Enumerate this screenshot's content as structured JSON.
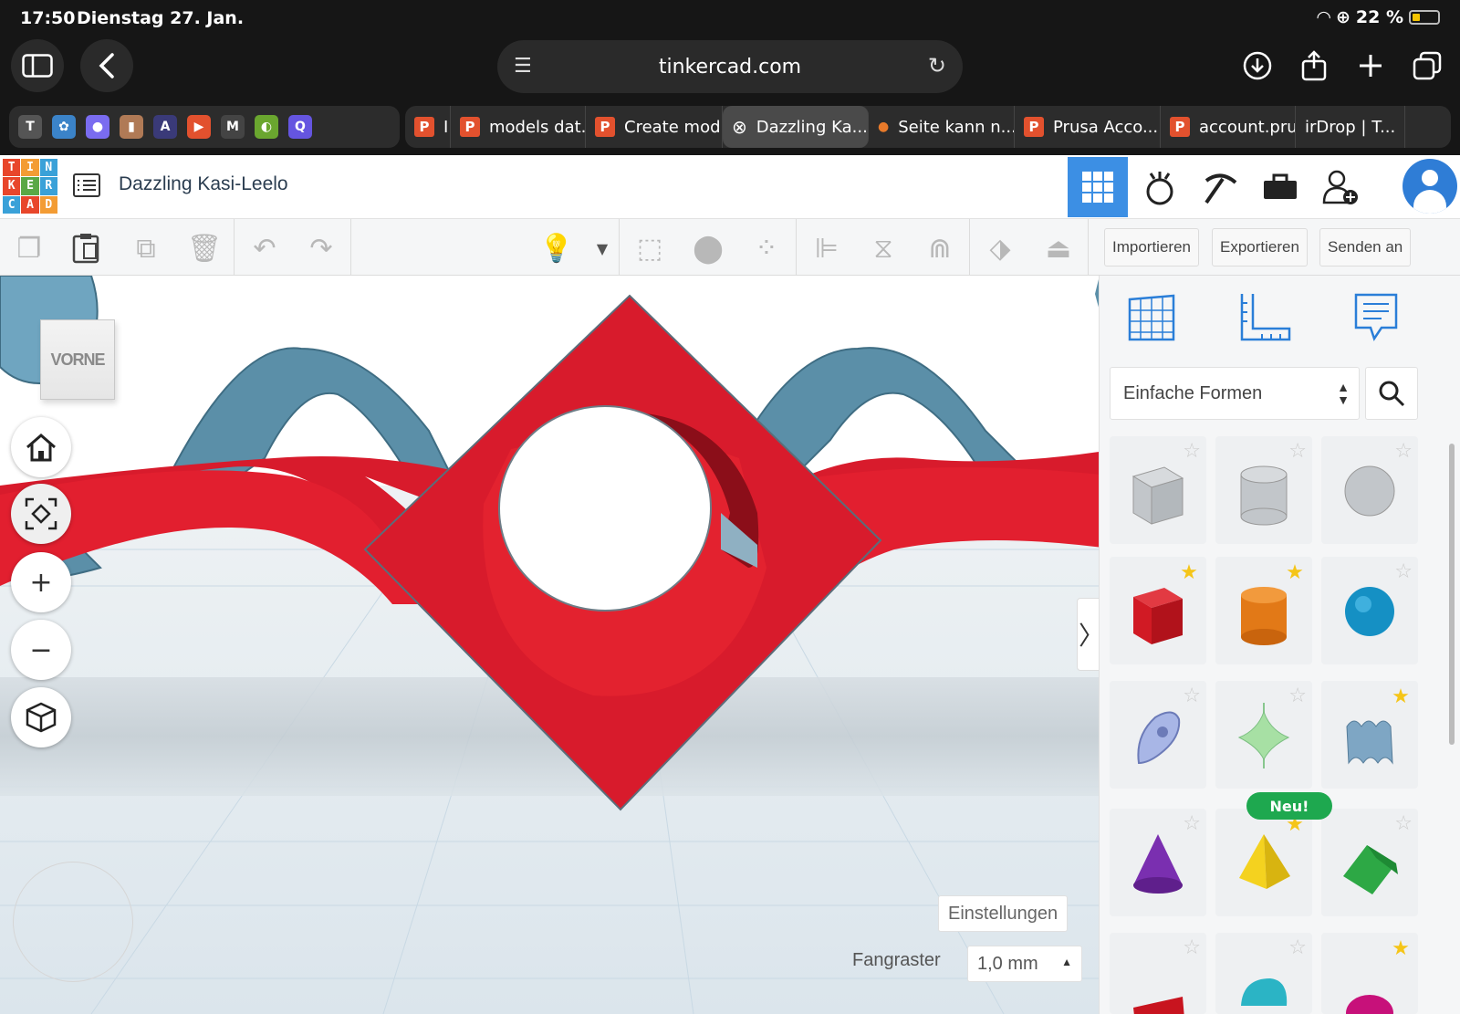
{
  "status_bar": {
    "time": "17:50",
    "date": "Dienstag 27. Jan.",
    "battery_text": "22 %"
  },
  "browser": {
    "url": "tinkercad.com",
    "favorites": [
      {
        "label": "T",
        "color": "#555555"
      },
      {
        "label": "✿",
        "color": "#3b83c8"
      },
      {
        "label": "●",
        "color": "#7a6cf0"
      },
      {
        "label": "▮",
        "color": "#b07a56"
      },
      {
        "label": "A",
        "color": "#3a3a78"
      },
      {
        "label": "▶",
        "color": "#e2512e"
      },
      {
        "label": "M",
        "color": "#444444"
      },
      {
        "label": "◐",
        "color": "#6aa62f"
      },
      {
        "label": "Q",
        "color": "#6555e0"
      }
    ],
    "tabs": [
      {
        "label": "I",
        "icon": "P"
      },
      {
        "label": "models dat...",
        "icon": "P"
      },
      {
        "label": "Create mod...",
        "icon": "P"
      },
      {
        "label": "Dazzling Ka...",
        "icon": "close",
        "active": true
      },
      {
        "label": "Seite kann n...",
        "icon": "dot"
      },
      {
        "label": "Prusa Acco...",
        "icon": "P"
      },
      {
        "label": "account.pru...",
        "icon": "P"
      },
      {
        "label": "irDrop | T...",
        "icon": ""
      }
    ]
  },
  "app": {
    "logo_letters": [
      "T",
      "I",
      "N",
      "K",
      "E",
      "R",
      "C",
      "A",
      "D"
    ],
    "logo_colors": [
      "#e8462b",
      "#f39c34",
      "#3aa1d8",
      "#e8462b",
      "#5aa846",
      "#3aa1d8",
      "#3aa1d8",
      "#e8462b",
      "#f39c34"
    ],
    "document_title": "Dazzling Kasi-Leelo",
    "accent_color": "#3c8fe4"
  },
  "toolbar": {
    "import_label": "Importieren",
    "export_label": "Exportieren",
    "send_label": "Senden an"
  },
  "workplane": {
    "view_cube_label": "VORNE",
    "settings_label": "Einstellungen",
    "snap_label": "Fangraster",
    "snap_value": "1,0 mm",
    "model_color": "#d81b2c",
    "hole_color": "#5b8fa8"
  },
  "shapes_panel": {
    "category": "Einfache Formen",
    "new_badge": "Neu!",
    "shapes": [
      {
        "name": "box-hole",
        "favorite": false
      },
      {
        "name": "cylinder-hole",
        "favorite": false
      },
      {
        "name": "sphere-hole",
        "favorite": false
      },
      {
        "name": "box",
        "favorite": true
      },
      {
        "name": "cylinder",
        "favorite": true
      },
      {
        "name": "sphere",
        "favorite": false
      },
      {
        "name": "scribble",
        "favorite": false
      },
      {
        "name": "spinning-top",
        "favorite": false
      },
      {
        "name": "shape-generator",
        "favorite": true
      },
      {
        "name": "cone",
        "favorite": false
      },
      {
        "name": "pyramid",
        "favorite": true
      },
      {
        "name": "roof",
        "favorite": false
      },
      {
        "name": "text",
        "favorite": false
      },
      {
        "name": "half-cylinder",
        "favorite": false
      },
      {
        "name": "paraboloid",
        "favorite": true
      }
    ]
  }
}
